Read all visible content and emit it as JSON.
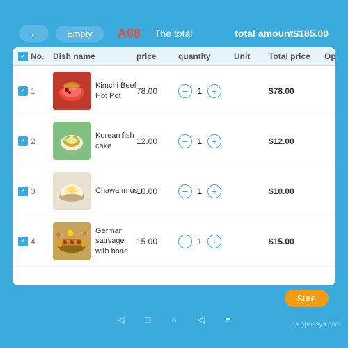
{
  "header": {
    "back_label": "←",
    "empty_label": "Empty",
    "table_id": "A08",
    "total_label": "The total",
    "total_amount_label": "total amount$185.00"
  },
  "table": {
    "columns": [
      "No.",
      "Dish name",
      "price",
      "quantity",
      "Unit",
      "Total price",
      "Operate"
    ],
    "rows": [
      {
        "no": "1",
        "dish_name": "Kimchi Beef Hot Pot",
        "price": "78.00",
        "quantity": "1",
        "unit": "",
        "total_price": "$78.00",
        "food_class": "food-1"
      },
      {
        "no": "2",
        "dish_name": "Korean fish cake",
        "price": "12.00",
        "quantity": "1",
        "unit": "",
        "total_price": "$12.00",
        "food_class": "food-2"
      },
      {
        "no": "3",
        "dish_name": "Chawanmushi",
        "price": "10.00",
        "quantity": "1",
        "unit": "",
        "total_price": "$10.00",
        "food_class": "food-3"
      },
      {
        "no": "4",
        "dish_name": "German sausage with bone",
        "price": "15.00",
        "quantity": "1",
        "unit": "",
        "total_price": "$15.00",
        "food_class": "food-4"
      }
    ]
  },
  "buttons": {
    "sure_label": "Sure",
    "minus_label": "−",
    "plus_label": "+"
  },
  "nav": {
    "icons": [
      "◁",
      "○",
      "□",
      "◁",
      "≡"
    ]
  },
  "watermark": "es.gpossys.com",
  "colors": {
    "primary": "#3aabdc",
    "accent": "#e74c3c",
    "sure_btn": "#f39c12"
  }
}
